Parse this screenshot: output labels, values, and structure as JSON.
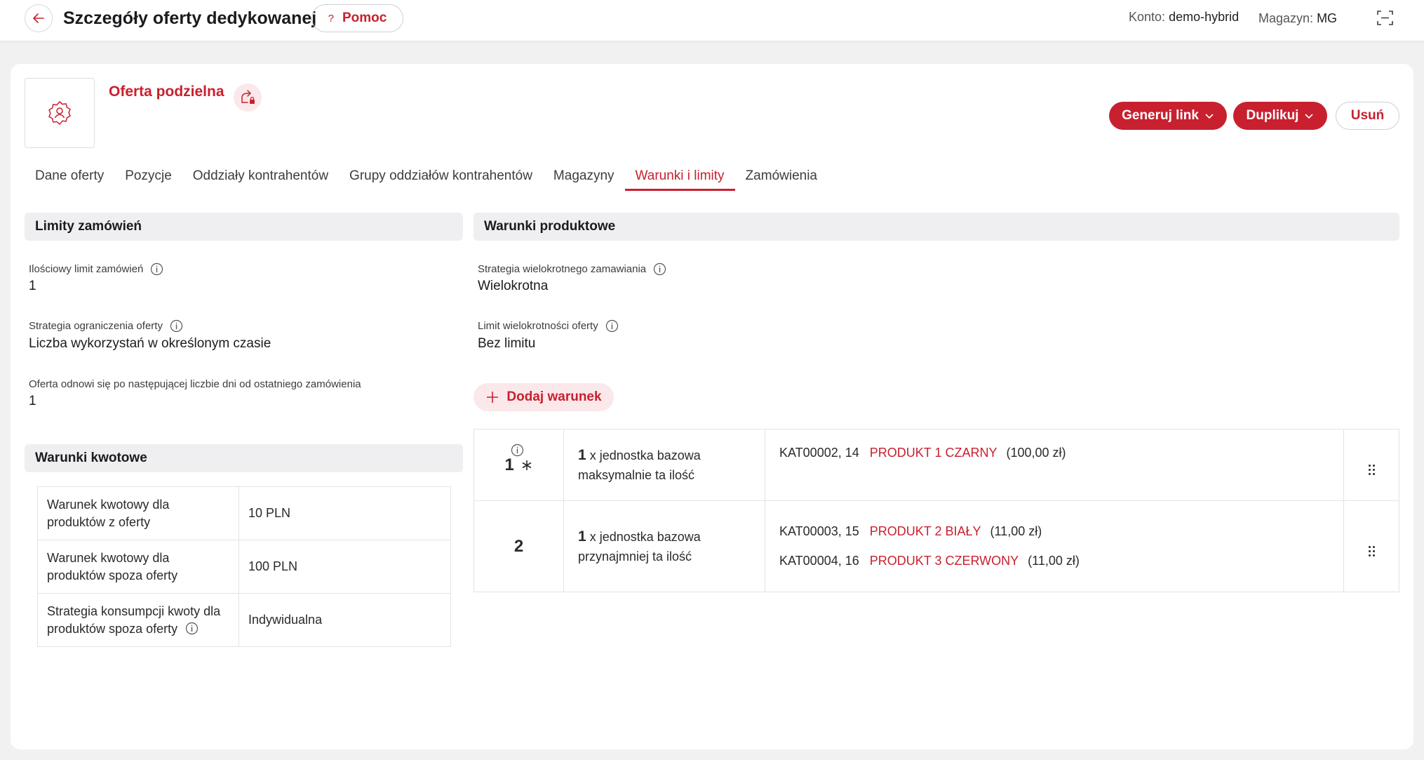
{
  "header": {
    "title": "Szczegóły oferty dedykowanej",
    "help_label": "Pomoc",
    "account_label": "Konto:",
    "account_value": "demo-hybrid",
    "warehouse_label": "Magazyn:",
    "warehouse_value": "MG"
  },
  "offer": {
    "name": "Oferta podzielna",
    "actions": {
      "generate_link": "Generuj link",
      "duplicate": "Duplikuj",
      "delete": "Usuń"
    }
  },
  "tabs": [
    {
      "label": "Dane oferty",
      "active": false
    },
    {
      "label": "Pozycje",
      "active": false
    },
    {
      "label": "Oddziały kontrahentów",
      "active": false
    },
    {
      "label": "Grupy oddziałów kontrahentów",
      "active": false
    },
    {
      "label": "Magazyny",
      "active": false
    },
    {
      "label": "Warunki i limity",
      "active": true
    },
    {
      "label": "Zamówienia",
      "active": false
    }
  ],
  "order_limits": {
    "title": "Limity zamówień",
    "quantity_limit_label": "Ilościowy limit zamówień",
    "quantity_limit_value": "1",
    "strategy_label": "Strategia ograniczenia oferty",
    "strategy_value": "Liczba wykorzystań w określonym czasie",
    "renew_label": "Oferta odnowi się po następującej liczbie dni od ostatniego zamówienia",
    "renew_value": "1"
  },
  "amount_conditions": {
    "title": "Warunki kwotowe",
    "rows": [
      {
        "key": "Warunek kwotowy dla produktów z oferty",
        "value": "10 PLN"
      },
      {
        "key": "Warunek kwotowy dla produktów spoza oferty",
        "value": "100 PLN"
      },
      {
        "key": "Strategia konsumpcji kwoty dla produktów spoza oferty",
        "value": "Indywidualna"
      }
    ]
  },
  "product_conditions": {
    "title": "Warunki produktowe",
    "multi_strategy_label": "Strategia wielokrotnego zamawiania",
    "multi_strategy_value": "Wielokrotna",
    "multi_limit_label": "Limit wielokrotności oferty",
    "multi_limit_value": "Bez limitu",
    "add_condition_label": "Dodaj warunek",
    "rows": [
      {
        "number": "1",
        "qty": "1",
        "qty_text1": "x jednostka bazowa",
        "qty_text2": "maksymalnie ta ilość",
        "products": [
          {
            "code": "KAT00002, 14",
            "name": "PRODUKT 1 CZARNY",
            "price": "(100,00 zł)"
          }
        ]
      },
      {
        "number": "2",
        "qty": "1",
        "qty_text1": "x jednostka bazowa",
        "qty_text2": "przynajmniej ta ilość",
        "products": [
          {
            "code": "KAT00003, 15",
            "name": "PRODUKT 2 BIAŁY",
            "price": "(11,00 zł)"
          },
          {
            "code": "KAT00004, 16",
            "name": "PRODUKT 3 CZERWONY",
            "price": "(11,00 zł)"
          }
        ]
      }
    ]
  },
  "colors": {
    "accent": "#c8202f",
    "accent_light": "#fbe8ea",
    "section_bg": "#efeff1"
  }
}
